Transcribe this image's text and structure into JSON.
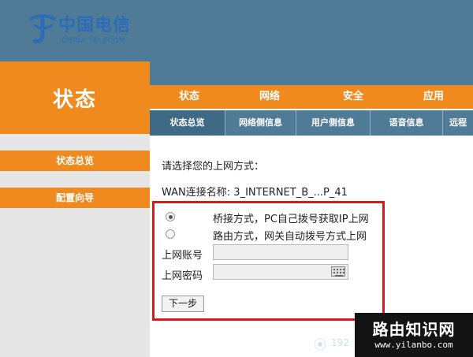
{
  "header": {
    "logo_cn": "中国电信",
    "logo_en": "CHINA TELECOM"
  },
  "sidebar": {
    "title": "状态",
    "items": [
      {
        "label": "状态总览"
      },
      {
        "label": "配置向导"
      }
    ]
  },
  "nav": {
    "main": [
      {
        "label": "状态"
      },
      {
        "label": "网络"
      },
      {
        "label": "安全"
      },
      {
        "label": "应用"
      }
    ],
    "sub": [
      {
        "label": "状态总览",
        "active": true
      },
      {
        "label": "网络侧信息"
      },
      {
        "label": "用户侧信息"
      },
      {
        "label": "语音信息"
      },
      {
        "label": "远程"
      }
    ]
  },
  "content": {
    "prompt": "请选择您的上网方式：",
    "wan_label": "WAN连接名称:",
    "wan_value": "3_INTERNET_B_...P_41",
    "options": [
      {
        "label": "桥接方式，PC自己拨号获取IP上网",
        "selected": true
      },
      {
        "label": "路由方式，网关自动拨号方式上网",
        "selected": false
      }
    ],
    "account_label": "上网账号",
    "password_label": "上网密码",
    "next_button": "下一步"
  },
  "watermark": {
    "title": "路由知识网",
    "url": "www.yilanbo.com",
    "ip_fragment": "192"
  },
  "colors": {
    "header_blue": "#4f7b96",
    "orange": "#f08a1e",
    "highlight_red": "#d71a20"
  }
}
